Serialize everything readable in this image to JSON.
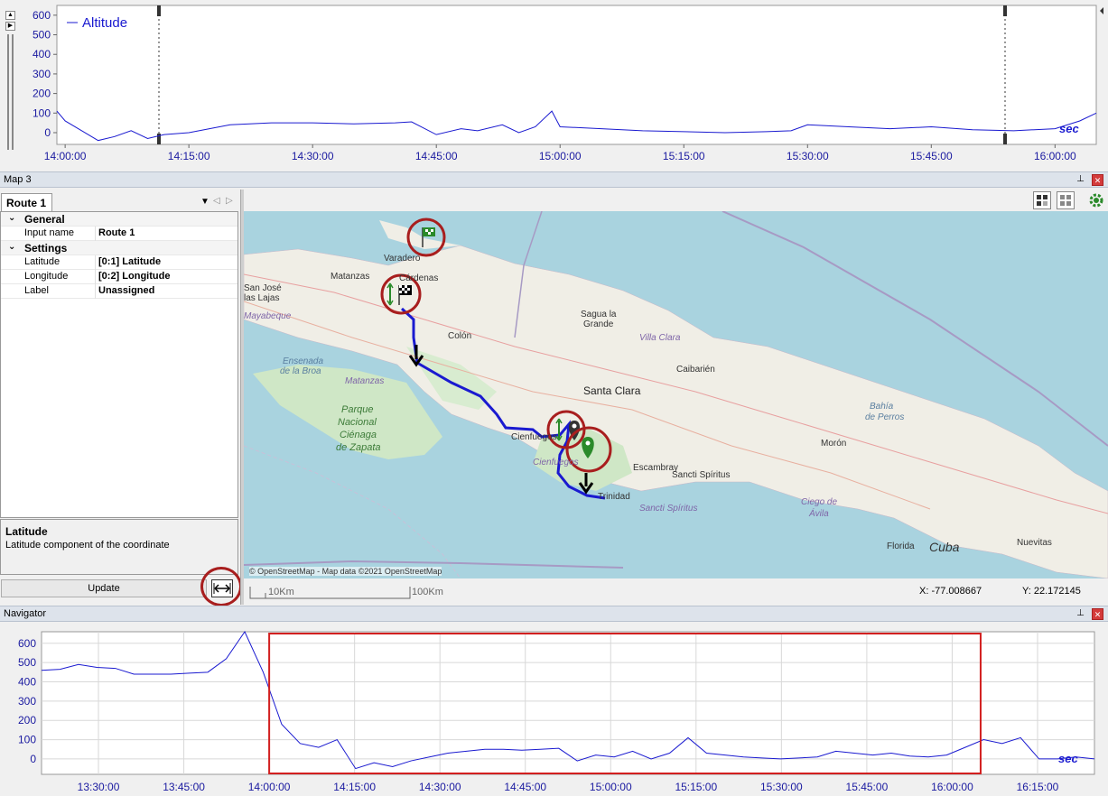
{
  "top_chart": {
    "legend": "Altitude",
    "unit_label": "sec",
    "series_color": "#1a1ad0",
    "y_ticks": [
      "600",
      "500",
      "400",
      "300",
      "200",
      "100",
      "0"
    ],
    "x_ticks": [
      "14:00:00",
      "14:15:00",
      "14:30:00",
      "14:45:00",
      "15:00:00",
      "15:15:00",
      "15:30:00",
      "15:45:00",
      "16:00:00"
    ],
    "scroll_up_icon": "triangle-up-icon",
    "scroll_right_icon": "triangle-right-icon"
  },
  "map_panel": {
    "title": "Map 3",
    "tab_label": "Route 1",
    "properties": {
      "general_label": "General",
      "input_name_label": "Input name",
      "input_name_value": "Route 1",
      "settings_label": "Settings",
      "latitude_label": "Latitude",
      "latitude_value": "[0:1] Latitude",
      "longitude_label": "Longitude",
      "longitude_value": "[0:2] Longitude",
      "label_label": "Label",
      "label_value": "Unassigned"
    },
    "description": {
      "title": "Latitude",
      "text": "Latitude component of the coordinate"
    },
    "update_button": "Update",
    "attribution": "© OpenStreetMap - Map data ©2021 OpenStreetMap",
    "scale_small": "10Km",
    "scale_large": "100Km",
    "coord_x": "X: -77.008667",
    "coord_y": "Y: 22.172145",
    "map_labels": {
      "varadero": "Varadero",
      "cardenas": "Cárdenas",
      "matanzas": "Matanzas",
      "san_jose": "San José",
      "las_lajas": "las Lajas",
      "mayabeque": "Mayabeque",
      "colon": "Colón",
      "sagua": "Sagua la",
      "grande": "Grande",
      "villa_clara": "Villa Clara",
      "caibarien": "Caibarién",
      "ensenada": "Ensenada",
      "de_la_broa": "de la Broa",
      "matanzas_region": "Matanzas",
      "santa_clara": "Santa Clara",
      "bahia": "Bahía",
      "de_perros": "de Perros",
      "parque": "Parque",
      "nacional": "Nacional",
      "cienaga": "Ciénaga",
      "de_zapata": "de Zapata",
      "cienfuegos_city": "Cienfuegos",
      "cienfuegos_region": "Cienfuegos",
      "moron": "Morón",
      "escambray": "Escambray",
      "sancti_spiritus_city": "Sancti Spíritus",
      "sancti_spiritus_region": "Sancti Spíritus",
      "trinidad": "Trinidad",
      "ciego": "Ciego de",
      "avila": "Ávila",
      "florida": "Florida",
      "cuba": "Cuba",
      "nuevitas": "Nuevitas"
    }
  },
  "navigator": {
    "title": "Navigator",
    "unit_label": "sec",
    "y_ticks": [
      "600",
      "500",
      "400",
      "300",
      "200",
      "100",
      "0"
    ],
    "x_ticks": [
      "13:30:00",
      "13:45:00",
      "14:00:00",
      "14:15:00",
      "14:30:00",
      "14:45:00",
      "15:00:00",
      "15:15:00",
      "15:30:00",
      "15:45:00",
      "16:00:00",
      "16:15:00"
    ],
    "selection_color": "#d21f1f"
  },
  "chart_data": [
    {
      "type": "line",
      "title": "",
      "series": [
        {
          "name": "Altitude",
          "x": [
            "13:59:00",
            "14:00:00",
            "14:02:00",
            "14:04:00",
            "14:06:00",
            "14:08:00",
            "14:10:00",
            "14:12:00",
            "14:15:00",
            "14:20:00",
            "14:25:00",
            "14:30:00",
            "14:35:00",
            "14:40:00",
            "14:42:00",
            "14:45:00",
            "14:48:00",
            "14:50:00",
            "14:53:00",
            "14:55:00",
            "14:57:00",
            "14:59:00",
            "15:00:00",
            "15:05:00",
            "15:10:00",
            "15:15:00",
            "15:20:00",
            "15:25:00",
            "15:28:00",
            "15:30:00",
            "15:35:00",
            "15:40:00",
            "15:45:00",
            "15:50:00",
            "15:55:00",
            "16:00:00",
            "16:03:00",
            "16:05:00"
          ],
          "values": [
            110,
            60,
            10,
            -40,
            -20,
            10,
            -30,
            -10,
            0,
            40,
            50,
            50,
            45,
            50,
            55,
            -10,
            20,
            10,
            40,
            0,
            30,
            110,
            30,
            20,
            10,
            5,
            0,
            5,
            10,
            40,
            30,
            20,
            30,
            15,
            10,
            20,
            60,
            100
          ]
        }
      ],
      "ylim": [
        -60,
        650
      ],
      "x_ticks": [
        "14:00:00",
        "14:15:00",
        "14:30:00",
        "14:45:00",
        "15:00:00",
        "15:15:00",
        "15:30:00",
        "15:45:00",
        "16:00:00"
      ],
      "legend": "top-left"
    },
    {
      "type": "line",
      "title": "",
      "series": [
        {
          "values": [
            460,
            465,
            490,
            475,
            470,
            440,
            440,
            440,
            445,
            450,
            520,
            660,
            450,
            180,
            80,
            60,
            100,
            -50,
            -20,
            -40,
            -10,
            10,
            30,
            40,
            50,
            50,
            45,
            50,
            55,
            -10,
            20,
            10,
            40,
            0,
            30,
            110,
            30,
            20,
            10,
            5,
            0,
            5,
            10,
            40,
            30,
            20,
            30,
            15,
            10,
            20,
            60,
            100,
            80,
            110,
            0,
            0,
            10,
            0
          ]
        }
      ],
      "ylim": [
        -80,
        660
      ],
      "x_ticks": [
        "13:30:00",
        "13:45:00",
        "14:00:00",
        "14:15:00",
        "14:30:00",
        "14:45:00",
        "15:00:00",
        "15:15:00",
        "15:30:00",
        "15:45:00",
        "16:00:00",
        "16:15:00"
      ],
      "selection_range": [
        "14:00:00",
        "16:05:00"
      ]
    }
  ]
}
